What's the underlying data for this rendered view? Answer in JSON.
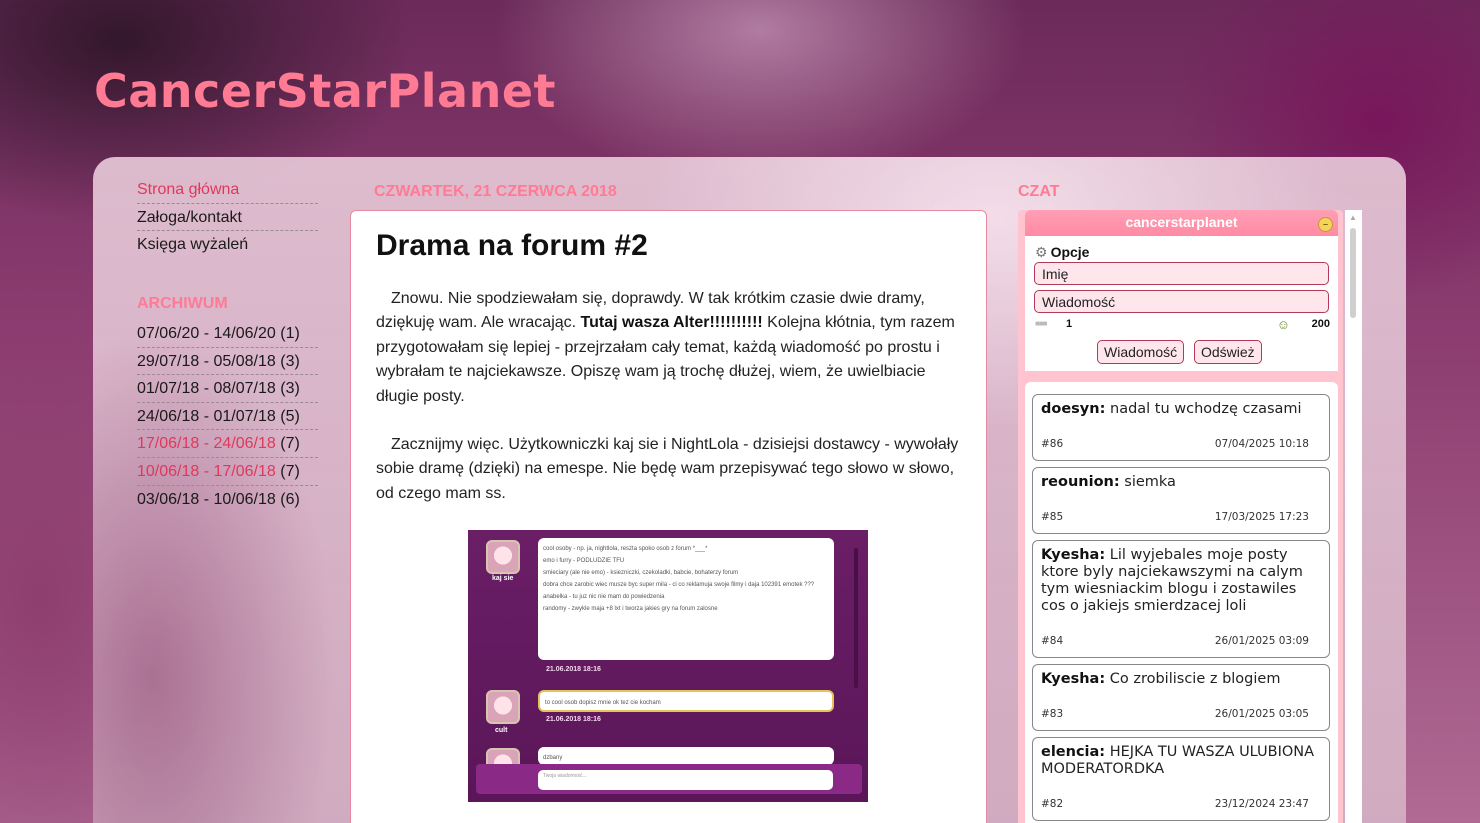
{
  "blog": {
    "title": "CancerStarPlanet"
  },
  "nav": {
    "items": [
      {
        "label": "Strona główna",
        "active": true
      },
      {
        "label": "Załoga/kontakt",
        "active": false
      },
      {
        "label": "Księga wyżaleń",
        "active": false
      }
    ]
  },
  "archive": {
    "title": "ARCHIWUM",
    "items": [
      {
        "range": "07/06/20 - 14/06/20",
        "count": "(1)",
        "highlight": false
      },
      {
        "range": "29/07/18 - 05/08/18",
        "count": "(3)",
        "highlight": false
      },
      {
        "range": "01/07/18 - 08/07/18",
        "count": "(3)",
        "highlight": false
      },
      {
        "range": "24/06/18 - 01/07/18",
        "count": "(5)",
        "highlight": false
      },
      {
        "range": "17/06/18 - 24/06/18",
        "count": "(7)",
        "highlight": true
      },
      {
        "range": "10/06/18 - 17/06/18",
        "count": "(7)",
        "highlight": true
      },
      {
        "range": "03/06/18 - 10/06/18",
        "count": "(6)",
        "highlight": false
      }
    ]
  },
  "post": {
    "date": "czwartek, 21 czerwca 2018",
    "title": "Drama na forum #2",
    "p1_before": "Znowu. Nie spodziewałam się, doprawdy. W tak krótkim czasie dwie dramy, dziękuję wam. Ale wracając. ",
    "p1_bold": "Tutaj wasza Alter!!!!!!!!!!",
    "p1_after": " Kolejna kłótnia, tym razem przygotowałam się lepiej - przejrzałam cały temat, każdą wiadomość po prostu i wybrałam te najciekawsze. Opiszę wam ją trochę dłużej, wiem, że uwielbiacie długie posty.",
    "p2": "Zacznijmy więc. Użytkowniczki kaj sie i NightLola - dzisiejsi dostawcy - wywołały sobie dramę (dzięki) na emespe. Nie będę wam przepisywać tego słowo w słowo, od czego mam ss.",
    "image": {
      "msg1_user": "kaj sie",
      "msg1_lines": [
        "cool osoby - np. ja, nightlola, reszta spoko osob z forum *___*",
        "emo i furry - PODLUDZIE TFU",
        "smieciary (ale nie emo) - ksiezniczki, czekoladki, babcie, bohaterzy forum",
        "dobra chce zarobic wiec musze byc super mila - ci co reklamuja swoje filmy i daja 102391 emotek ???",
        "anabelka - tu juz nic nie mam do powiedzenia",
        "randomy - zwykle maja +8 lxt i tworza jakies gry na forum zalosne"
      ],
      "msg1_time": "21.06.2018 18:16",
      "msg2_user": "cult",
      "msg2_text": "to cool osob dopisz mnie ok tez cie kocham",
      "msg2_time": "21.06.2018 18:16",
      "msg3_text": "dzbany",
      "input_placeholder": "Twoja wiadomość..."
    }
  },
  "chat": {
    "header": "CZAT",
    "box_title": "cancerstarplanet",
    "options_label": "Opcje",
    "name_field": "Imię",
    "message_field": "Wiadomość",
    "online_count": "1",
    "char_limit": "200",
    "send_button": "Wiadomość",
    "refresh_button": "Odśwież",
    "messages": [
      {
        "author": "doesyn:",
        "text": "nadal tu wchodzę czasami",
        "id": "#86",
        "time": "07/04/2025 10:18"
      },
      {
        "author": "reounion:",
        "text": "siemka",
        "id": "#85",
        "time": "17/03/2025 17:23"
      },
      {
        "author": "Kyesha:",
        "text": "Lil wyjebales moje posty ktore byly najciekawszymi na calym tym wiesniackim blogu i zostawiles cos o jakiejs smierdzacej loli",
        "id": "#84",
        "time": "26/01/2025 03:09"
      },
      {
        "author": "Kyesha:",
        "text": "Co zrobiliscie z blogiem",
        "id": "#83",
        "time": "26/01/2025 03:05"
      },
      {
        "author": "elencia:",
        "text": "HEJKA TU WASZA ULUBIONA MODERATORDKA",
        "id": "#82",
        "time": "23/12/2024 23:47"
      }
    ]
  }
}
